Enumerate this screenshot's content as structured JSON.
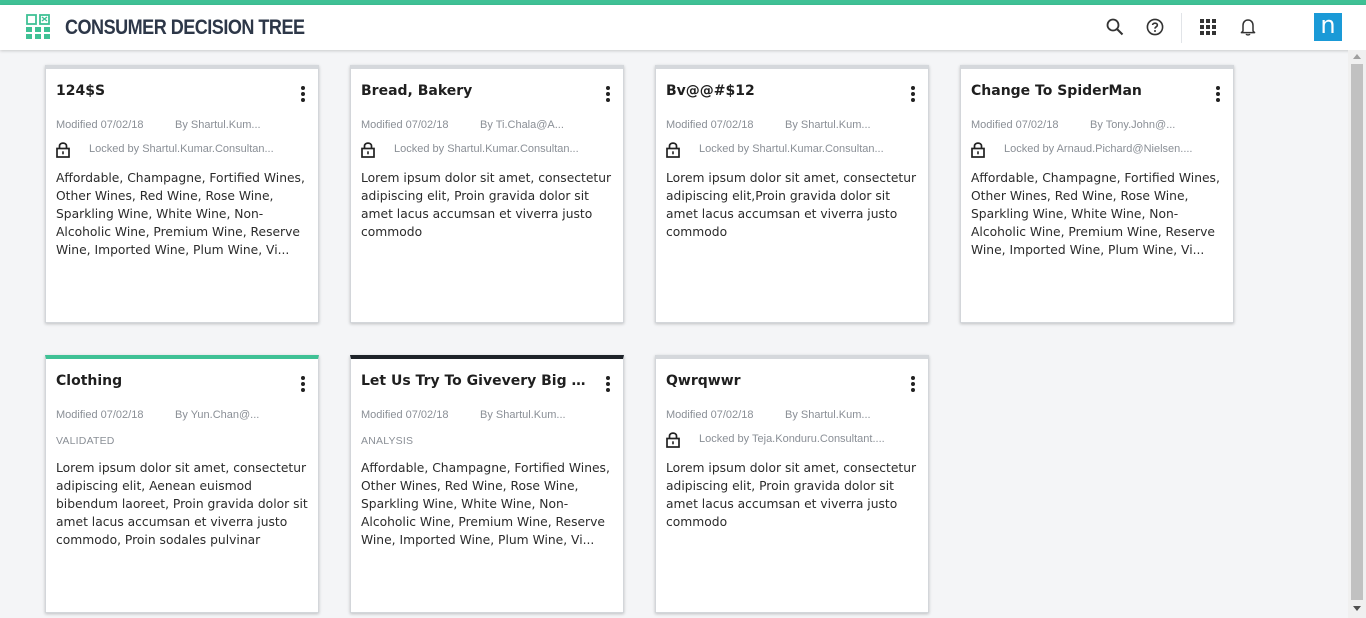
{
  "header": {
    "title": "CONSUMER DECISION TREE",
    "brand_letter": "n",
    "icons": [
      "search-icon",
      "help-icon",
      "apps-grid-icon",
      "bell-icon"
    ]
  },
  "colors": {
    "accent": "#3fc195",
    "header_text": "#2d3748",
    "brand": "#1a9ad7",
    "analysis_bar": "#1e2329",
    "default_bar": "#d5d8dc"
  },
  "cards": [
    {
      "title": "124$S",
      "modified": "Modified 07/02/18",
      "by": "By Shartul.Kum...",
      "lock": "Locked by Shartul.Kumar.Consultan...",
      "status": "",
      "description": "Affordable, Champagne, Fortified Wines, Other Wines, Red Wine, Rose Wine, Sparkling Wine, White Wine, Non-Alcoholic Wine, Premium Wine, Reserve Wine, Imported Wine, Plum Wine, Vi..."
    },
    {
      "title": "Bread, Bakery",
      "modified": "Modified 07/02/18",
      "by": "By Ti.Chala@A...",
      "lock": "Locked by Shartul.Kumar.Consultan...",
      "status": "",
      "description": "Lorem ipsum dolor sit amet, consectetur adipiscing elit, Proin gravida dolor sit amet lacus accumsan et viverra justo commodo"
    },
    {
      "title": "Bv@@#$12",
      "modified": "Modified 07/02/18",
      "by": "By Shartul.Kum...",
      "lock": "Locked by Shartul.Kumar.Consultan...",
      "status": "",
      "description": "Lorem ipsum dolor sit amet, consectetur adipiscing elit,Proin gravida dolor sit amet lacus accumsan et viverra justo commodo"
    },
    {
      "title": "Change To SpiderMan",
      "modified": "Modified 07/02/18",
      "by": "By Tony.John@...",
      "lock": "Locked by Arnaud.Pichard@Nielsen....",
      "status": "",
      "description": "Affordable, Champagne, Fortified Wines, Other Wines, Red Wine, Rose Wine, Sparkling Wine, White Wine, Non-Alcoholic Wine, Premium Wine, Reserve Wine, Imported Wine, Plum Wine, Vi..."
    },
    {
      "title": "Clothing",
      "modified": "Modified 07/02/18",
      "by": "By Yun.Chan@...",
      "lock": "",
      "status": "VALIDATED",
      "description": "Lorem ipsum dolor sit amet, consectetur adipiscing elit, Aenean euismod bibendum laoreet, Proin gravida dolor sit amet lacus accumsan et viverra justo commodo, Proin sodales pulvinar"
    },
    {
      "title": "Let Us Try To Givevery Big Na...",
      "modified": "Modified 07/02/18",
      "by": "By Shartul.Kum...",
      "lock": "",
      "status": "ANALYSIS",
      "description": "Affordable, Champagne, Fortified Wines, Other Wines, Red Wine, Rose Wine, Sparkling Wine, White Wine, Non-Alcoholic Wine, Premium Wine, Reserve Wine, Imported Wine, Plum Wine, Vi..."
    },
    {
      "title": "Qwrqwwr",
      "modified": "Modified 07/02/18",
      "by": "By Shartul.Kum...",
      "lock": "Locked by Teja.Konduru.Consultant....",
      "status": "",
      "description": "Lorem ipsum dolor sit amet, consectetur adipiscing elit, Proin gravida dolor sit amet lacus accumsan et viverra justo commodo"
    }
  ]
}
